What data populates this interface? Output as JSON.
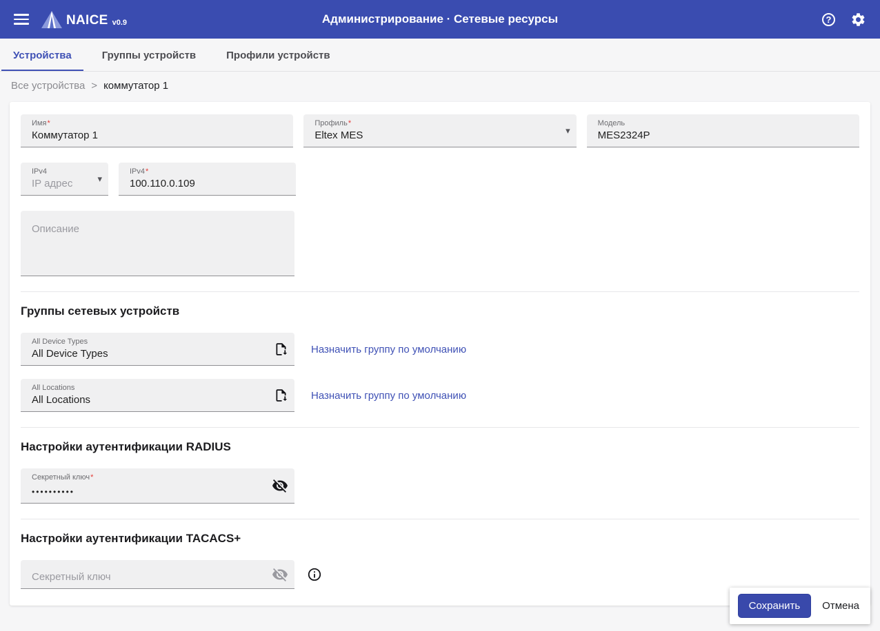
{
  "header": {
    "app_name": "NAICE",
    "app_version": "v0.9",
    "title": "Администрирование · Сетевые ресурсы"
  },
  "icons": {
    "dropdown": "▾",
    "help": "?"
  },
  "colors": {
    "appbar": "#3a4cb0",
    "primary": "#3949ab",
    "link": "#3f51b5",
    "required": "#e53935"
  },
  "tabs": [
    {
      "label": "Устройства",
      "active": true
    },
    {
      "label": "Группы устройств",
      "active": false
    },
    {
      "label": "Профили устройств",
      "active": false
    }
  ],
  "breadcrumb": {
    "root": "Все устройства",
    "separator": ">",
    "current": "коммутатор 1"
  },
  "form": {
    "name": {
      "label": "Имя",
      "required": "*",
      "value": "Коммутатор 1"
    },
    "profile": {
      "label": "Профиль",
      "required": "*",
      "value": "Eltex MES"
    },
    "model": {
      "label": "Модель",
      "value": "MES2324P"
    },
    "ip_type": {
      "label": "IPv4",
      "placeholder": "IP адрес"
    },
    "ipv4": {
      "label": "IPv4",
      "required": "*",
      "value": "100.110.0.109"
    },
    "description": {
      "placeholder": "Описание"
    }
  },
  "groups_section": {
    "title": "Группы сетевых устройств",
    "items": [
      {
        "label": "All Device Types",
        "value": "All Device Types",
        "link": "Назначить группу по умолчанию"
      },
      {
        "label": "All Locations",
        "value": "All Locations",
        "link": "Назначить группу по умолчанию"
      }
    ]
  },
  "radius_section": {
    "title": "Настройки аутентификации RADIUS",
    "secret": {
      "label": "Секретный ключ",
      "required": "*",
      "value": "••••••••••"
    }
  },
  "tacacs_section": {
    "title": "Настройки аутентификации TACACS+",
    "secret": {
      "label": "Секретный ключ",
      "placeholder": "Секретный ключ"
    }
  },
  "actions": {
    "save": "Сохранить",
    "cancel": "Отмена"
  }
}
